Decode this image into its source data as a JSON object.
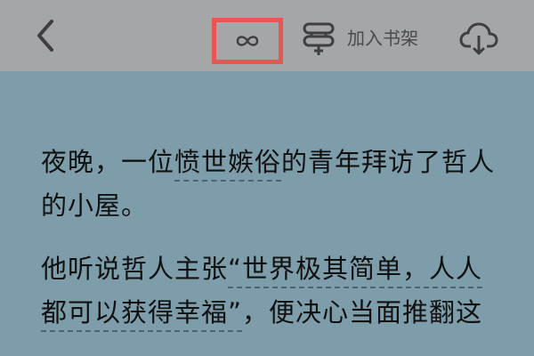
{
  "toolbar": {
    "back_icon": "chevron-left-icon",
    "infinity_icon": "infinity-icon",
    "shelf_icon": "add-to-bookshelf-icon",
    "shelf_label": "加入书架",
    "download_icon": "cloud-download-icon",
    "highlight_color": "#e85552"
  },
  "reader": {
    "background_color": "#7e9daa",
    "paragraphs": [
      {
        "segments": [
          {
            "text": "夜晚，一位",
            "note": false
          },
          {
            "text": "愤世嫉俗",
            "note": true
          },
          {
            "text": "的青年拜访了哲人的小屋。",
            "note": false
          }
        ]
      },
      {
        "segments": [
          {
            "text": "他听说哲人主张",
            "note": false
          },
          {
            "text": "“世界极其简单，人人都可以获得幸福”",
            "note": true
          },
          {
            "text": "，便决心当面推翻这",
            "note": false
          }
        ]
      }
    ]
  }
}
